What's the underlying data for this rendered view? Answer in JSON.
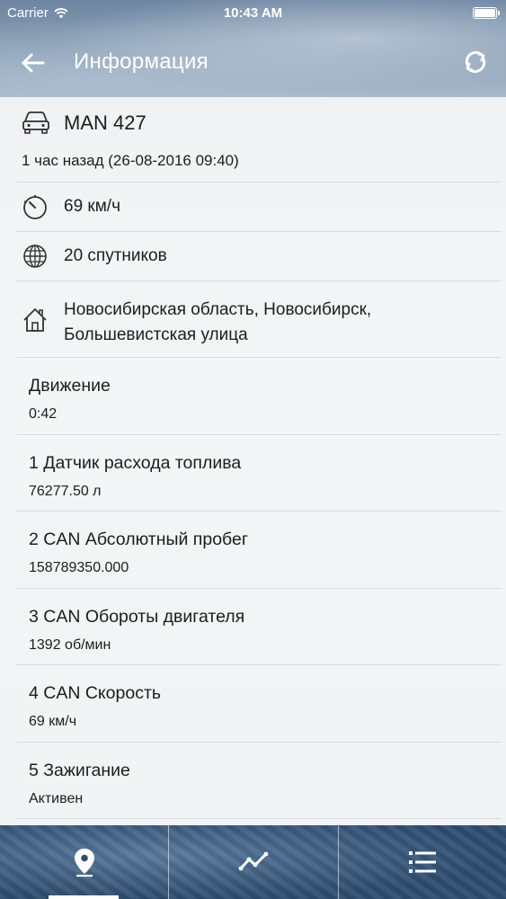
{
  "status_bar": {
    "carrier": "Carrier",
    "time": "10:43 AM"
  },
  "nav": {
    "title": "Информация",
    "back_icon": "arrow-left-icon",
    "refresh_icon": "refresh-icon"
  },
  "vehicle": {
    "name": "MAN 427",
    "time_ago": "1 час назад (26-08-2016 09:40)"
  },
  "speed": {
    "text": "69 км/ч"
  },
  "satellites": {
    "text": "20 спутников"
  },
  "address": {
    "text": "Новосибирская область, Новосибирск, Большевистская улица"
  },
  "sensors": [
    {
      "label": "Движение",
      "value": "0:42"
    },
    {
      "label": "1 Датчик расхода топлива",
      "value": "76277.50 л"
    },
    {
      "label": "2 CAN Абсолютный пробег",
      "value": "158789350.000"
    },
    {
      "label": "3 CAN Обороты двигателя",
      "value": "1392 об/мин"
    },
    {
      "label": "4 CAN Скорость",
      "value": "69 км/ч"
    },
    {
      "label": "5 Зажигание",
      "value": "Активен"
    }
  ],
  "tabbar": {
    "tabs": [
      {
        "icon": "map-pin-icon",
        "active": true
      },
      {
        "icon": "chart-line-icon",
        "active": false
      },
      {
        "icon": "list-icon",
        "active": false
      }
    ]
  },
  "colors": {
    "accent": "#ffffff",
    "tabbar_bg": "#2c4a6c",
    "divider": "#d9dcdf"
  }
}
